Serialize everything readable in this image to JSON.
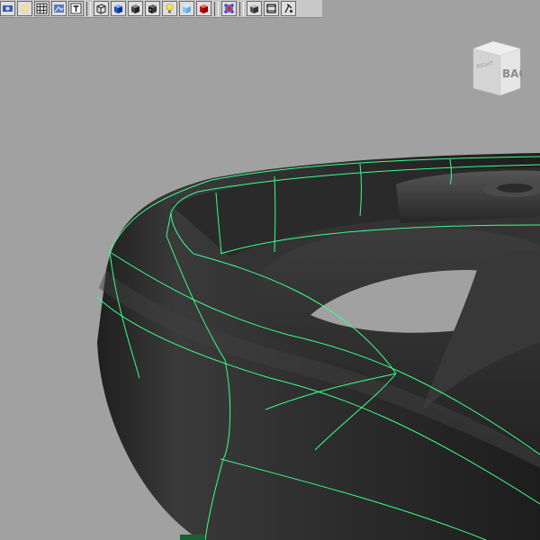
{
  "viewport": {
    "background": "#a1a1a1",
    "mesh_color": "#2f2f2f",
    "wireframe_color": "#39ff8a"
  },
  "shelf": {
    "groups": [
      [
        "select-camera-icon",
        "light-sphere-icon",
        "grid-icon",
        "image-plane-icon",
        "text-icon"
      ],
      [
        "wireframe-cube-icon",
        "shaded-cube-icon",
        "smooth-shade-icon",
        "textured-cube-icon",
        "light-bulb-icon",
        "xray-cube-icon",
        "red-cube-icon"
      ],
      [
        "isolate-select-icon"
      ],
      [
        "camera-gate-icon",
        "resolution-gate-icon",
        "film-gate-icon"
      ]
    ]
  },
  "viewcube": {
    "face_label": "BACK",
    "side_label": "RIGHT"
  }
}
